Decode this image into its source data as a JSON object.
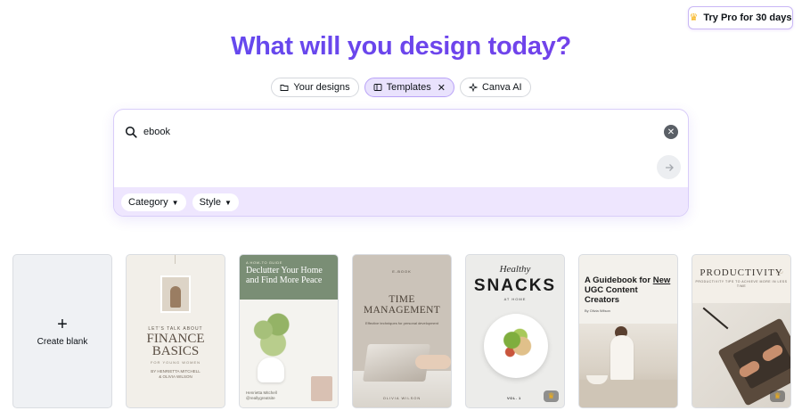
{
  "pro_button": {
    "label": "Try Pro for 30 days",
    "icon": "crown-icon"
  },
  "hero": {
    "title": "What will you design today?"
  },
  "tabs": [
    {
      "label": "Your designs",
      "icon": "folder-icon",
      "active": false
    },
    {
      "label": "Templates",
      "icon": "template-icon",
      "active": true
    },
    {
      "label": "Canva AI",
      "icon": "sparkle-icon",
      "active": false
    }
  ],
  "search": {
    "value": "ebook"
  },
  "filters": [
    {
      "label": "Category"
    },
    {
      "label": "Style"
    }
  ],
  "cards": {
    "create_blank": {
      "label": "Create blank"
    },
    "finance": {
      "kicker": "LET'S TALK ABOUT",
      "title_line1": "FINANCE",
      "title_line2": "BASICS",
      "subtitle": "FOR YOUNG WOMEN",
      "author_line1": "BY HENRIETTA MITCHELL",
      "author_line2": "& OLIVIA WILSON"
    },
    "declutter": {
      "kicker": "A HOW-TO GUIDE",
      "title": "Declutter Your Home and Find More Peace",
      "caption_line1": "Henrietta Mitchell",
      "caption_line2": "@reallygreatsite"
    },
    "time": {
      "kicker": "E-BOOK",
      "title_line1": "TIME",
      "title_line2": "MANAGEMENT",
      "subtitle": "Effective techniques for personal development",
      "author": "OLIVIA WILSON"
    },
    "snacks": {
      "kicker": "Healthy",
      "title": "SNACKS",
      "subtitle": "AT HOME",
      "volume": "VOL. 1"
    },
    "ugc": {
      "title_prefix": "A Guidebook for",
      "title_underlined": "New",
      "title_suffix": "UGC Content Creators",
      "byline": "By Olivia Wilson"
    },
    "productivity": {
      "title": "PRODUCTIVITY",
      "subtitle": "PRODUCTIVITY TIPS TO ACHIEVE MORE IN LESS TIME"
    }
  },
  "colors": {
    "accent": "#6f47ef",
    "active_chip_bg": "#e9e2fd",
    "filter_bar": "#eee6fe",
    "crown": "#f6b00f"
  }
}
